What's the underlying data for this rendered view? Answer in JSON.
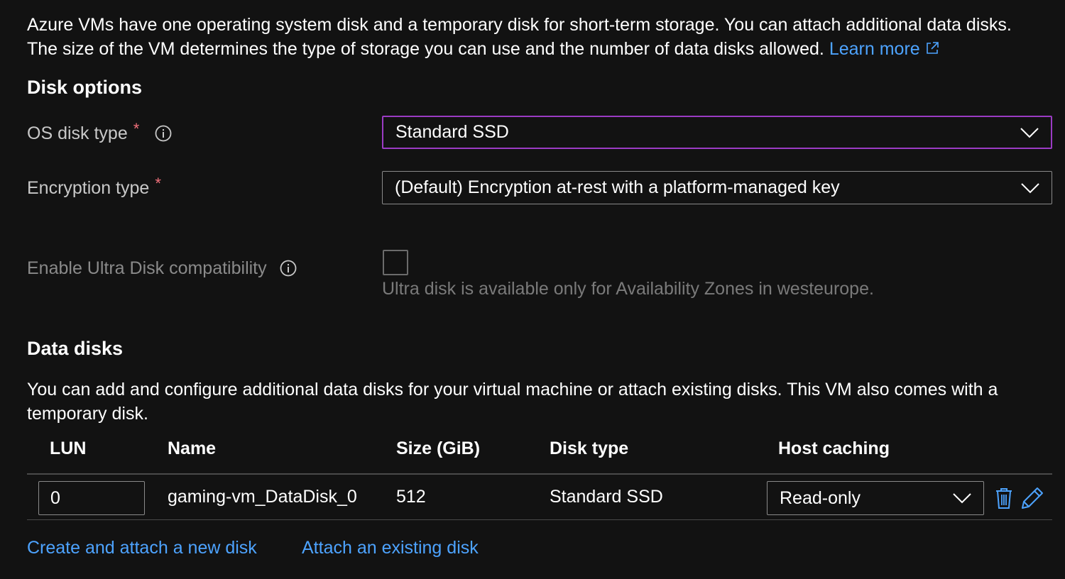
{
  "intro": {
    "line1": "Azure VMs have one operating system disk and a temporary disk for short-term storage. You can attach additional data disks.",
    "line2": "The size of the VM determines the type of storage you can use and the number of data disks allowed.",
    "learn_more": "Learn more",
    "learn_more_icon": "external-link-icon"
  },
  "disk_options": {
    "heading": "Disk options",
    "os_disk_type": {
      "label": "OS disk type",
      "required_mark": "*",
      "info_icon": "info-icon",
      "value": "Standard SSD"
    },
    "encryption_type": {
      "label": "Encryption type",
      "required_mark": "*",
      "value": "(Default) Encryption at-rest with a platform-managed key"
    },
    "ultra_disk": {
      "label": "Enable Ultra Disk compatibility",
      "info_icon": "info-icon",
      "checked": false,
      "hint": "Ultra disk is available only for Availability Zones in westeurope."
    }
  },
  "data_disks": {
    "heading": "Data disks",
    "description_line1": "You can add and configure additional data disks for your virtual machine or attach existing disks. This VM also comes with a",
    "description_line2": "temporary disk.",
    "columns": [
      "LUN",
      "Name",
      "Size (GiB)",
      "Disk type",
      "Host caching"
    ],
    "rows": [
      {
        "lun": "0",
        "name": "gaming-vm_DataDisk_0",
        "size": "512",
        "disk_type": "Standard SSD",
        "host_caching": "Read-only",
        "delete_icon": "trash-icon",
        "edit_icon": "pencil-icon"
      }
    ],
    "create_link": "Create and attach a new disk",
    "attach_link": "Attach an existing disk"
  },
  "colors": {
    "background": "#121212",
    "link": "#4da3ff",
    "required": "#f1707b",
    "focus_border": "#9b3bc4"
  }
}
